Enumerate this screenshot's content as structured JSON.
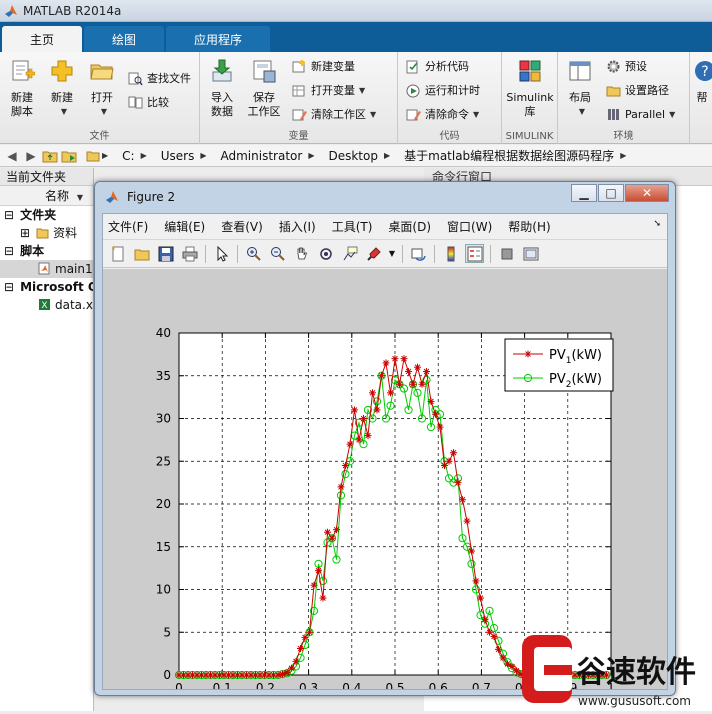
{
  "app": {
    "title": "MATLAB R2014a"
  },
  "tabs": [
    {
      "label": "主页",
      "active": true
    },
    {
      "label": "绘图",
      "active": false
    },
    {
      "label": "应用程序",
      "active": false
    }
  ],
  "ribbon": {
    "file": {
      "label": "文件",
      "new_script": "新建\n脚本",
      "new": "新建",
      "open": "打开",
      "find_files": "查找文件",
      "compare": "比较"
    },
    "variable": {
      "label": "变量",
      "import_data": "导入\n数据",
      "save_workspace": "保存\n工作区",
      "new_variable": "新建变量",
      "open_variable": "打开变量",
      "clear_workspace": "清除工作区"
    },
    "code": {
      "label": "代码",
      "analyze_code": "分析代码",
      "run_and_time": "运行和计时",
      "clear_commands": "清除命令"
    },
    "simulink": {
      "label": "SIMULINK",
      "button": "Simulink\n库"
    },
    "environment": {
      "label": "环境",
      "layout": "布局",
      "preferences": "预设",
      "set_path": "设置路径",
      "parallel": "Parallel",
      "help": "帮"
    }
  },
  "address": {
    "segments": [
      "C:",
      "Users",
      "Administrator",
      "Desktop",
      "基于matlab编程根据数据绘图源码程序"
    ]
  },
  "current_folder": {
    "title": "当前文件夹",
    "name_col": "名称",
    "groups": [
      {
        "label": "文件夹",
        "items": [
          "资料"
        ]
      },
      {
        "label": "脚本",
        "items": [
          "main1"
        ]
      },
      {
        "label": "Microsoft O",
        "items": [
          "data.x"
        ]
      }
    ]
  },
  "command_window": {
    "title": "命令行窗口"
  },
  "figure": {
    "title": "Figure 2",
    "menu": [
      "文件(F)",
      "编辑(E)",
      "查看(V)",
      "插入(I)",
      "工具(T)",
      "桌面(D)",
      "窗口(W)",
      "帮助(H)"
    ]
  },
  "chart_data": {
    "type": "line",
    "xlim": [
      0,
      1
    ],
    "ylim": [
      0,
      40
    ],
    "xticks": [
      "0",
      "0.1",
      "0.2",
      "0.3",
      "0.4",
      "0.5",
      "0.6",
      "0.7",
      "0.8",
      "0.9",
      "1"
    ],
    "yticks": [
      "0",
      "5",
      "10",
      "15",
      "20",
      "25",
      "30",
      "35",
      "40"
    ],
    "grid": true,
    "legend_position": "top-right",
    "series": [
      {
        "name": "PV1(kW)",
        "legend_main": "PV",
        "legend_sub": "1",
        "legend_suffix": "(kW)",
        "color": "#cc0000",
        "marker": "star",
        "x": [
          0,
          0.0104,
          0.0208,
          0.0313,
          0.0417,
          0.0521,
          0.0625,
          0.0729,
          0.0833,
          0.0938,
          0.1042,
          0.1146,
          0.125,
          0.1354,
          0.1458,
          0.1563,
          0.1667,
          0.1771,
          0.1875,
          0.1979,
          0.2083,
          0.2188,
          0.2292,
          0.2396,
          0.25,
          0.2604,
          0.2708,
          0.2813,
          0.2917,
          0.3021,
          0.3125,
          0.3229,
          0.3333,
          0.3438,
          0.3542,
          0.3646,
          0.375,
          0.3854,
          0.3958,
          0.4063,
          0.4167,
          0.4271,
          0.4375,
          0.4479,
          0.4583,
          0.4688,
          0.4792,
          0.4896,
          0.5,
          0.5104,
          0.5208,
          0.5313,
          0.5417,
          0.5521,
          0.5625,
          0.5729,
          0.5833,
          0.5938,
          0.6042,
          0.6146,
          0.625,
          0.6354,
          0.6458,
          0.6563,
          0.6667,
          0.6771,
          0.6875,
          0.6979,
          0.7083,
          0.7188,
          0.7292,
          0.7396,
          0.75,
          0.7604,
          0.7708,
          0.7813,
          0.7917,
          0.8021,
          0.8125,
          0.8229,
          0.8333,
          0.8438,
          0.8542,
          0.8646,
          0.875,
          0.8854,
          0.8958,
          0.9063,
          0.9167,
          0.9271,
          0.9375,
          0.9479,
          0.9583,
          0.9688,
          0.9792,
          0.9896
        ],
        "y": [
          0,
          0,
          0,
          0,
          0,
          0,
          0,
          0,
          0,
          0,
          0,
          0,
          0,
          0,
          0,
          0,
          0,
          0,
          0,
          0,
          0,
          0,
          0,
          0.1,
          0.3,
          0.8,
          1.6,
          3.1,
          4.4,
          5.0,
          10.5,
          12.2,
          9.0,
          16.7,
          16.0,
          17.0,
          22.0,
          24.5,
          27.0,
          31.0,
          27.5,
          30.0,
          28.0,
          33.0,
          31.0,
          35.0,
          36.5,
          33.0,
          37.0,
          34.0,
          37.0,
          35.5,
          34.0,
          36.0,
          34.0,
          35.5,
          32.0,
          30.5,
          29.0,
          24.5,
          25.0,
          26.0,
          22.5,
          20.5,
          18.0,
          14.5,
          11.0,
          9.0,
          6.5,
          5.0,
          4.5,
          3.0,
          2.0,
          1.3,
          1.0,
          0.5,
          0.1,
          0,
          0,
          0,
          0,
          0,
          0,
          0,
          0,
          0,
          0,
          0,
          0,
          0,
          0,
          0,
          0,
          0,
          0,
          0
        ]
      },
      {
        "name": "PV2(kW)",
        "legend_main": "PV",
        "legend_sub": "2",
        "legend_suffix": "(kW)",
        "color": "#00cc00",
        "marker": "circle",
        "x": [
          0,
          0.0104,
          0.0208,
          0.0313,
          0.0417,
          0.0521,
          0.0625,
          0.0729,
          0.0833,
          0.0938,
          0.1042,
          0.1146,
          0.125,
          0.1354,
          0.1458,
          0.1563,
          0.1667,
          0.1771,
          0.1875,
          0.1979,
          0.2083,
          0.2188,
          0.2292,
          0.2396,
          0.25,
          0.2604,
          0.2708,
          0.2813,
          0.2917,
          0.3021,
          0.3125,
          0.3229,
          0.3333,
          0.3438,
          0.3542,
          0.3646,
          0.375,
          0.3854,
          0.3958,
          0.4063,
          0.4167,
          0.4271,
          0.4375,
          0.4479,
          0.4583,
          0.4688,
          0.4792,
          0.4896,
          0.5,
          0.5104,
          0.5208,
          0.5313,
          0.5417,
          0.5521,
          0.5625,
          0.5729,
          0.5833,
          0.5938,
          0.6042,
          0.6146,
          0.625,
          0.6354,
          0.6458,
          0.6563,
          0.6667,
          0.6771,
          0.6875,
          0.6979,
          0.7083,
          0.7188,
          0.7292,
          0.7396,
          0.75,
          0.7604,
          0.7708,
          0.7813,
          0.7917,
          0.8021,
          0.8125,
          0.8229,
          0.8333,
          0.8438,
          0.8542,
          0.8646,
          0.875,
          0.8854,
          0.8958,
          0.9063,
          0.9167,
          0.9271,
          0.9375,
          0.9479,
          0.9583,
          0.9688,
          0.9792,
          0.9896
        ],
        "y": [
          0,
          0,
          0,
          0,
          0,
          0,
          0,
          0,
          0,
          0,
          0,
          0,
          0,
          0,
          0,
          0,
          0,
          0,
          0,
          0,
          0,
          0,
          0,
          0.1,
          0.2,
          0.5,
          1.0,
          2.0,
          3.5,
          5.0,
          7.5,
          13.0,
          11.0,
          15.5,
          16.0,
          13.5,
          21.0,
          23.5,
          25.0,
          28.0,
          29.5,
          27.0,
          31.0,
          30.0,
          32.0,
          35.0,
          30.0,
          31.5,
          34.5,
          34.0,
          33.5,
          31.0,
          34.0,
          33.0,
          30.0,
          34.5,
          29.0,
          31.0,
          30.5,
          25.0,
          23.0,
          22.5,
          23.0,
          16.0,
          15.0,
          13.0,
          10.0,
          7.0,
          6.0,
          7.5,
          5.5,
          4.0,
          2.5,
          1.5,
          0.8,
          0.3,
          0.1,
          0,
          0,
          0,
          0,
          0,
          0,
          0,
          0,
          0,
          0,
          0,
          0,
          0,
          0,
          0,
          0,
          0,
          0,
          0
        ]
      }
    ]
  },
  "watermark": {
    "brand": "谷速软件",
    "url": "www.gususoft.com"
  }
}
